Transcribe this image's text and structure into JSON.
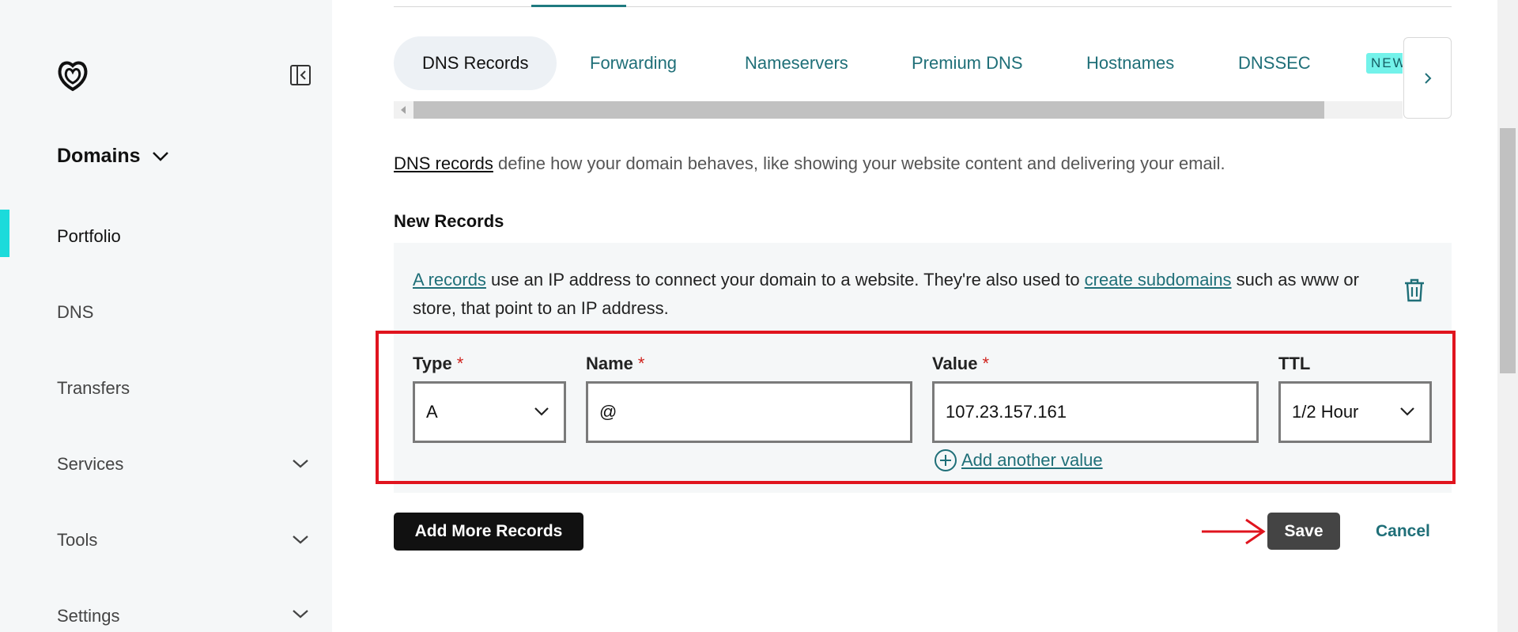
{
  "sidebar": {
    "section_title": "Domains",
    "items": [
      {
        "label": "Portfolio"
      },
      {
        "label": "DNS"
      },
      {
        "label": "Transfers"
      },
      {
        "label": "Services"
      },
      {
        "label": "Tools"
      },
      {
        "label": "Settings"
      }
    ]
  },
  "tabs": {
    "items": [
      {
        "label": "DNS Records"
      },
      {
        "label": "Forwarding"
      },
      {
        "label": "Nameservers"
      },
      {
        "label": "Premium DNS"
      },
      {
        "label": "Hostnames"
      },
      {
        "label": "DNSSEC"
      }
    ],
    "new_badge": "NEW"
  },
  "intro": {
    "link": "DNS records",
    "text": " define how your domain behaves, like showing your website content and delivering your email."
  },
  "new_records": {
    "title": "New Records",
    "description": {
      "link1": "A records",
      "text1": " use an IP address to connect your domain to a website. They're also used to ",
      "link2": "create subdomains",
      "text2": " such as www or store, that point to an IP address."
    },
    "fields": {
      "type_label": "Type",
      "type_value": "A",
      "name_label": "Name",
      "name_value": "@",
      "value_label": "Value",
      "value_value": "107.23.157.161",
      "ttl_label": "TTL",
      "ttl_value": "1/2 Hour",
      "required_mark": "*"
    },
    "add_value_label": "Add another value"
  },
  "actions": {
    "add_more": "Add More Records",
    "save": "Save",
    "cancel": "Cancel"
  },
  "colors": {
    "accent": "#1f6f78",
    "active_indicator": "#1bdbdb",
    "highlight_box": "#e0141e",
    "required": "#d0231d"
  }
}
